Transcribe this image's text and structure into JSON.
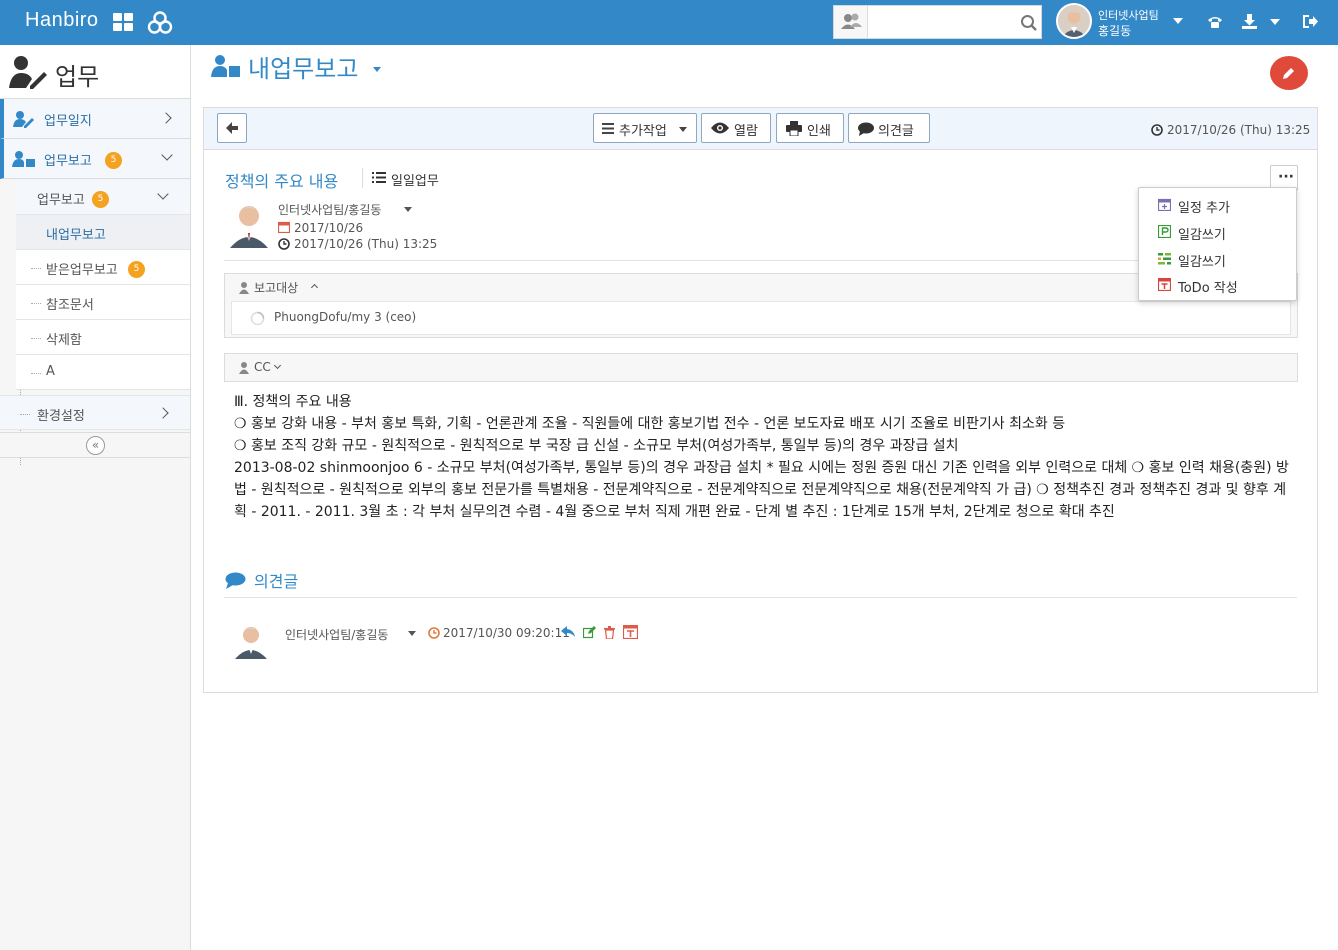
{
  "topbar": {
    "brand": "Hanbiro",
    "search_placeholder": "",
    "user_team": "인터넷사업팀",
    "user_name": "홍길동"
  },
  "sidebar": {
    "title": "업무",
    "items": [
      {
        "label": "업무일지"
      },
      {
        "label": "업무보고",
        "badge": "5"
      }
    ],
    "sub": [
      {
        "label": "업무보고",
        "badge": "5"
      },
      {
        "label": "내업무보고"
      },
      {
        "label": "받은업무보고",
        "badge": "5"
      },
      {
        "label": "참조문서"
      },
      {
        "label": "삭제함"
      },
      {
        "label": "A"
      },
      {
        "label": "환경설정"
      }
    ]
  },
  "page": {
    "title": "내업무보고"
  },
  "toolbar": {
    "add_task": "추가작업",
    "view": "열람",
    "print": "인쇄",
    "comment": "의견글",
    "date": "2017/10/26 (Thu) 13:25"
  },
  "doc": {
    "title": "정책의 주요 내용",
    "category": "일일업무",
    "author": "인터넷사업팀/홍길동",
    "date1": "2017/10/26",
    "date2": "2017/10/26 (Thu) 13:25",
    "report_target_label": "보고대상",
    "report_target": "PhuongDofu/my 3 (ceo)",
    "cc_label": "CC",
    "body": [
      "Ⅲ. 정책의 주요 내용",
      "❍ 홍보 강화 내용 - 부처 홍보 특화, 기획 - 언론관계 조율 - 직원들에 대한 홍보기법 전수 - 언론 보도자료 배포 시기 조율로 비판기사 최소화 등",
      "❍ 홍보 조직 강화 규모 - 원칙적으로 - 원칙적으로 부 국장 급 신설 - 소규모 부처(여성가족부, 통일부 등)의 경우 과장급 설치",
      "2013-08-02 shinmoonjoo 6 - 소규모 부처(여성가족부, 통일부 등)의 경우 과장급 설치 * 필요 시에는 정원 증원 대신 기존 인력을 외부 인력으로 대체 ❍ 홍보 인력 채용(충원) 방법 - 원칙적으로 - 원칙적으로 외부의 홍보 전문가를 특별채용 - 전문계약직으로 - 전문계약직으로 전문계약직으로 채용(전문계약직 가 급) ❍ 정책추진 경과 정책추진 경과 및 향후 계획 - 2011. - 2011. 3월 초 : 각 부처 실무의견 수렴 - 4월 중으로 부처 직제 개편 완료 - 단계 별 추진 : 1단계로 15개 부처, 2단계로 청으로 확대 추진"
    ]
  },
  "comments": {
    "title": "의견글",
    "author": "인터넷사업팀/홍길동",
    "date": "2017/10/30 09:20:11"
  },
  "dropdown": {
    "items": [
      {
        "label": "일정 추가",
        "icon": "calendar-add-icon",
        "color": "#7a6fb0"
      },
      {
        "label": "일감쓰기",
        "icon": "project-icon",
        "color": "#3a9a3a"
      },
      {
        "label": "일감쓰기",
        "icon": "gantt-icon",
        "color": "#3a9a3a"
      },
      {
        "label": "ToDo 작성",
        "icon": "todo-icon",
        "color": "#d9453a"
      }
    ]
  },
  "colors": {
    "accent": "#3389c8",
    "badge": "#f4a21f",
    "danger": "#e04a3a"
  }
}
